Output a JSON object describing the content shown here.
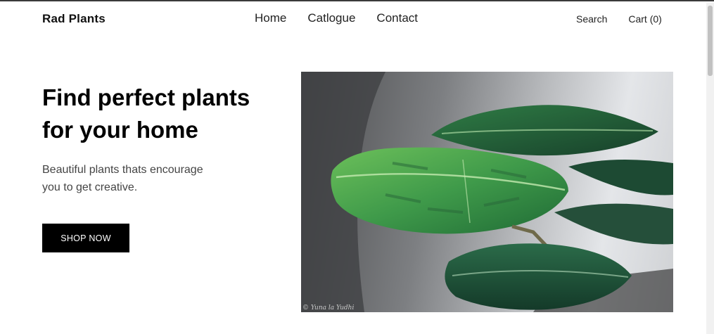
{
  "header": {
    "logo": "Rad Plants",
    "nav": [
      {
        "label": "Home"
      },
      {
        "label": "Catlogue"
      },
      {
        "label": "Contact"
      }
    ],
    "search_label": "Search",
    "cart_label": "Cart (0)"
  },
  "hero": {
    "title_line1": "Find perfect plants",
    "title_line2": "for your home",
    "subtitle_line1": "Beautiful plants thats encourage",
    "subtitle_line2": "you to get creative.",
    "cta_label": "SHOP NOW",
    "image_icon": "monstera-plant-photo"
  },
  "colors": {
    "text": "#111111",
    "button_bg": "#000000",
    "button_text": "#ffffff",
    "leaf_dark": "#1f4d33",
    "leaf_light": "#3f9a4a"
  }
}
